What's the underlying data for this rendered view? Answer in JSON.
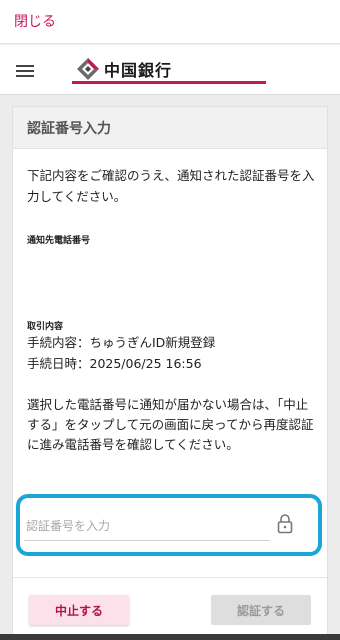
{
  "topbar": {
    "close_label": "閉じる"
  },
  "header": {
    "bank_name": "中国銀行",
    "brand_color": "#c2185b"
  },
  "card": {
    "title": "認証番号入力",
    "intro": "下記内容をご確認のうえ、通知された認証番号を入力してください。",
    "phone_heading": "通知先電話番号",
    "transaction_heading": "取引内容",
    "transaction_lines": [
      "手続内容：ちゅうぎんID新規登録",
      "手続日時：2025/06/25 16:56"
    ],
    "notice": "選択した電話番号に通知が届かない場合は、「中止する」をタップして元の画面に戻ってから再度認証に進み電話番号を確認してください。",
    "input": {
      "placeholder": "認証番号を入力",
      "value": ""
    },
    "buttons": {
      "cancel_label": "中止する",
      "verify_label": "認証する"
    }
  },
  "colors": {
    "highlight": "#1aa7d6",
    "cancel_bg": "#fde1ea",
    "disabled_bg": "#dedede"
  }
}
